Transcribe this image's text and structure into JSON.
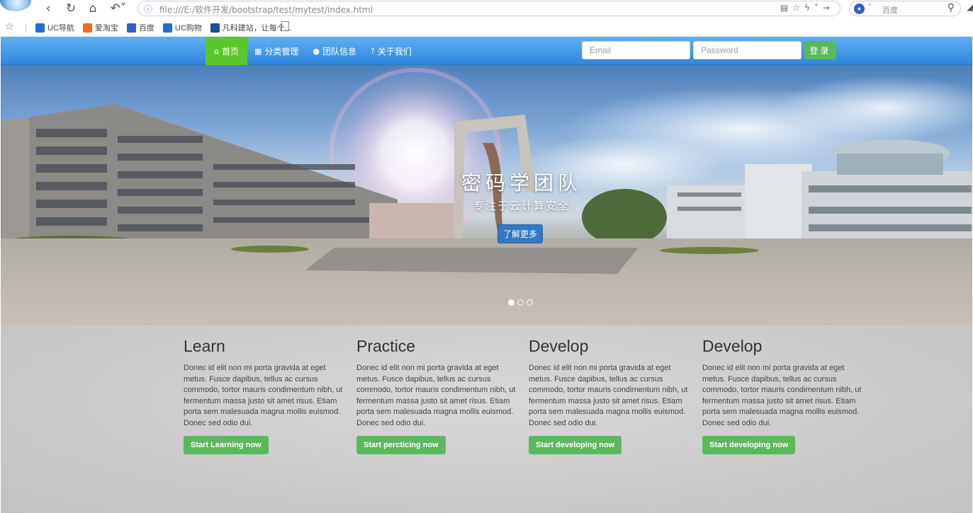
{
  "browser": {
    "url": "file:///E:/软件开发/bootstrap/test/mytest/index.html",
    "search_placeholder": "百度",
    "bookmarks": [
      {
        "label": "UC导航",
        "icon": "uc-nav-icon",
        "color": "#1f6fd1"
      },
      {
        "label": "爱淘宝",
        "icon": "taobao-icon",
        "color": "#f26a1b"
      },
      {
        "label": "百度",
        "icon": "baidu-icon",
        "color": "#2f5fd1"
      },
      {
        "label": "UC购物",
        "icon": "uc-shop-icon",
        "color": "#1f6fd1"
      },
      {
        "label": "凡科建站，让每个...",
        "icon": "fanke-icon",
        "color": "#1a4f9c"
      }
    ]
  },
  "navbar": {
    "items": [
      {
        "label": "首页",
        "icon": "home-icon",
        "glyph": "⌂"
      },
      {
        "label": "分类管理",
        "icon": "grid-icon",
        "glyph": "▦"
      },
      {
        "label": "团队信息",
        "icon": "user-icon",
        "glyph": "●"
      },
      {
        "label": "关于我们",
        "icon": "question-circle-icon",
        "glyph": "?"
      }
    ],
    "email_placeholder": "Email",
    "password_placeholder": "Password",
    "login_label": "登录"
  },
  "hero": {
    "title": "密码学团队",
    "subtitle": "专注于云计算安全",
    "button_label": "了解更多",
    "slides": 3,
    "active_slide": 1
  },
  "features": [
    {
      "title": "Learn",
      "text": "Donec id elit non mi porta gravida at eget metus. Fusce dapibus, tellus ac cursus commodo, tortor mauris condimentum nibh, ut fermentum massa justo sit amet risus. Etiam porta sem malesuada magna mollis euismod. Donec sed odio dui.",
      "button": "Start Learning now"
    },
    {
      "title": "Practice",
      "text": "Donec id elit non mi porta gravida at eget metus. Fusce dapibus, tellus ac cursus commodo, tortor mauris condimentum nibh, ut fermentum massa justo sit amet risus. Etiam porta sem malesuada magna mollis euismod. Donec sed odio dui.",
      "button": "Start percticing now"
    },
    {
      "title": "Develop",
      "text": "Donec id elit non mi porta gravida at eget metus. Fusce dapibus, tellus ac cursus commodo, tortor mauris condimentum nibh, ut fermentum massa justo sit amet risus. Etiam porta sem malesuada magna mollis euismod. Donec sed odio dui.",
      "button": "Start developing now"
    },
    {
      "title": "Develop",
      "text": "Donec id elit non mi porta gravida at eget metus. Fusce dapibus, tellus ac cursus commodo, tortor mauris condimentum nibh, ut fermentum massa justo sit amet risus. Etiam porta sem malesuada magna mollis euismod. Donec sed odio dui.",
      "button": "Start developing now"
    }
  ],
  "colors": {
    "navbar": "#3c93e6",
    "active_nav": "#5cc72c",
    "success": "#5cb85c",
    "primary": "#3278c2"
  }
}
